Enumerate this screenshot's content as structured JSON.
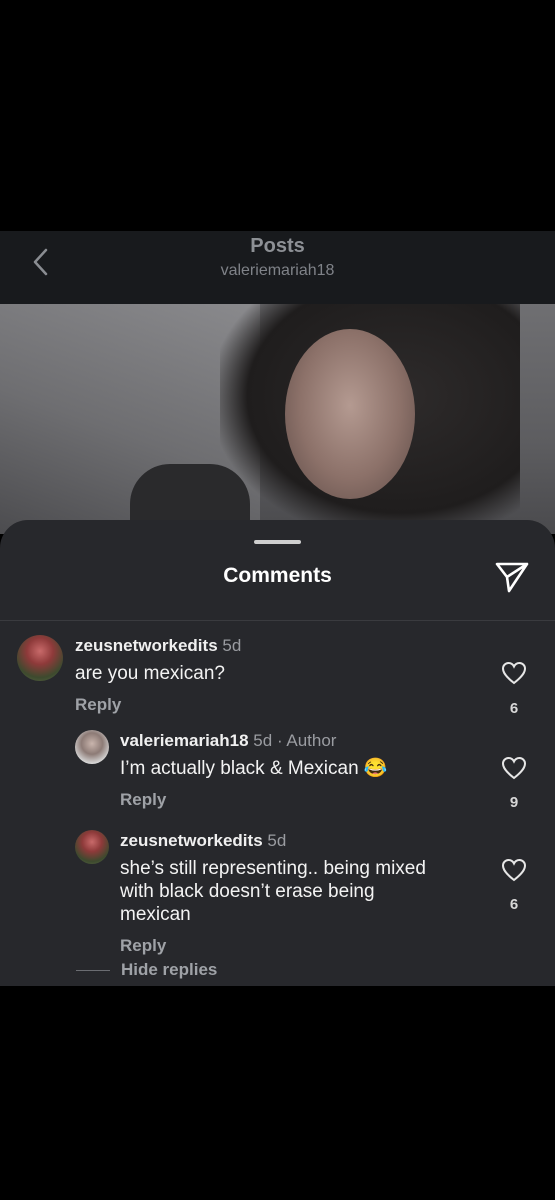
{
  "header": {
    "title": "Posts",
    "subtitle": "valeriemariah18"
  },
  "sheet": {
    "title": "Comments"
  },
  "comments": [
    {
      "username": "zeusnetworkedits",
      "time": "5d",
      "text": "are you mexican?",
      "reply_label": "Reply",
      "likes": "6"
    },
    {
      "username": "valeriemariah18",
      "time": "5d",
      "author_tag": "· Author",
      "text": "I’m actually black & Mexican 😂",
      "reply_label": "Reply",
      "likes": "9"
    },
    {
      "username": "zeusnetworkedits",
      "time": "5d",
      "text_lines": [
        "she’s still representing.. being mixed",
        "with black doesn’t erase being",
        "mexican"
      ],
      "reply_label": "Reply",
      "likes": "6"
    }
  ],
  "hide_replies_label": "Hide replies",
  "icons": {
    "back": "chevron-left-icon",
    "share": "paper-plane-icon",
    "like": "heart-outline-icon"
  },
  "colors": {
    "sheet_bg": "#27282c",
    "header_bg": "#181a1d",
    "muted_text": "#9fa2a7"
  }
}
